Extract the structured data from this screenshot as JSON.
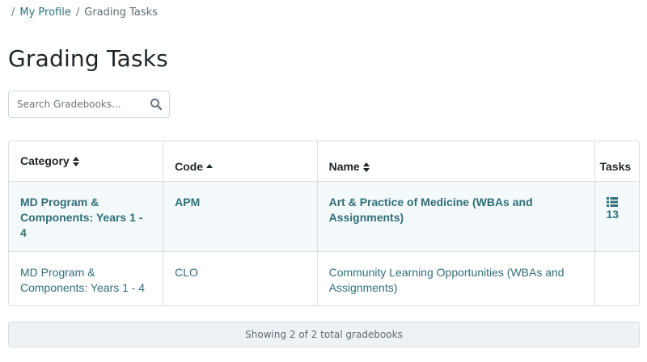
{
  "breadcrumb": {
    "separator": "/",
    "items": [
      {
        "label": "My Profile"
      },
      {
        "label": "Grading Tasks"
      }
    ]
  },
  "page": {
    "title": "Grading Tasks"
  },
  "search": {
    "placeholder": "Search Gradebooks...",
    "value": ""
  },
  "table": {
    "headers": {
      "category": "Category",
      "code": "Code",
      "name": "Name",
      "tasks": "Tasks"
    },
    "sort": {
      "category": "both",
      "code": "asc",
      "name": "both"
    },
    "rows": [
      {
        "category": "MD Program & Components: Years 1 - 4",
        "code": "APM",
        "name": "Art & Practice of Medicine (WBAs and Assignments)",
        "tasks": "13",
        "has_tasks_icon": true
      },
      {
        "category": "MD Program & Components: Years 1 - 4",
        "code": "CLO",
        "name": "Community Learning Opportunities (WBAs and Assignments)",
        "tasks": "",
        "has_tasks_icon": false
      }
    ]
  },
  "footer": {
    "summary": "Showing 2 of 2 total gradebooks"
  },
  "colors": {
    "link": "#2f6f78",
    "row_highlight": "#f4f9fb",
    "border": "#d9dee1"
  },
  "icons": {
    "search": "search-icon",
    "sort_both": "sort-icon",
    "sort_asc": "sort-asc-icon",
    "tasks": "list-icon"
  }
}
